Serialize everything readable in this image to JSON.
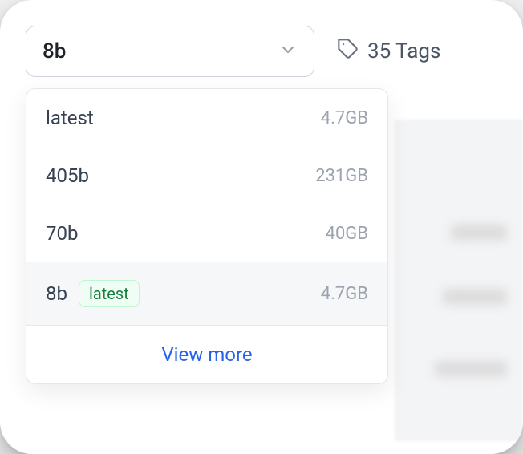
{
  "select": {
    "value": "8b"
  },
  "tags": {
    "count_label": "35 Tags"
  },
  "dropdown": {
    "items": [
      {
        "label": "latest",
        "size": "4.7GB",
        "is_latest": false,
        "selected": false
      },
      {
        "label": "405b",
        "size": "231GB",
        "is_latest": false,
        "selected": false
      },
      {
        "label": "70b",
        "size": "40GB",
        "is_latest": false,
        "selected": false
      },
      {
        "label": "8b",
        "size": "4.7GB",
        "is_latest": true,
        "selected": true
      }
    ],
    "latest_badge": "latest",
    "view_more": "View more"
  }
}
